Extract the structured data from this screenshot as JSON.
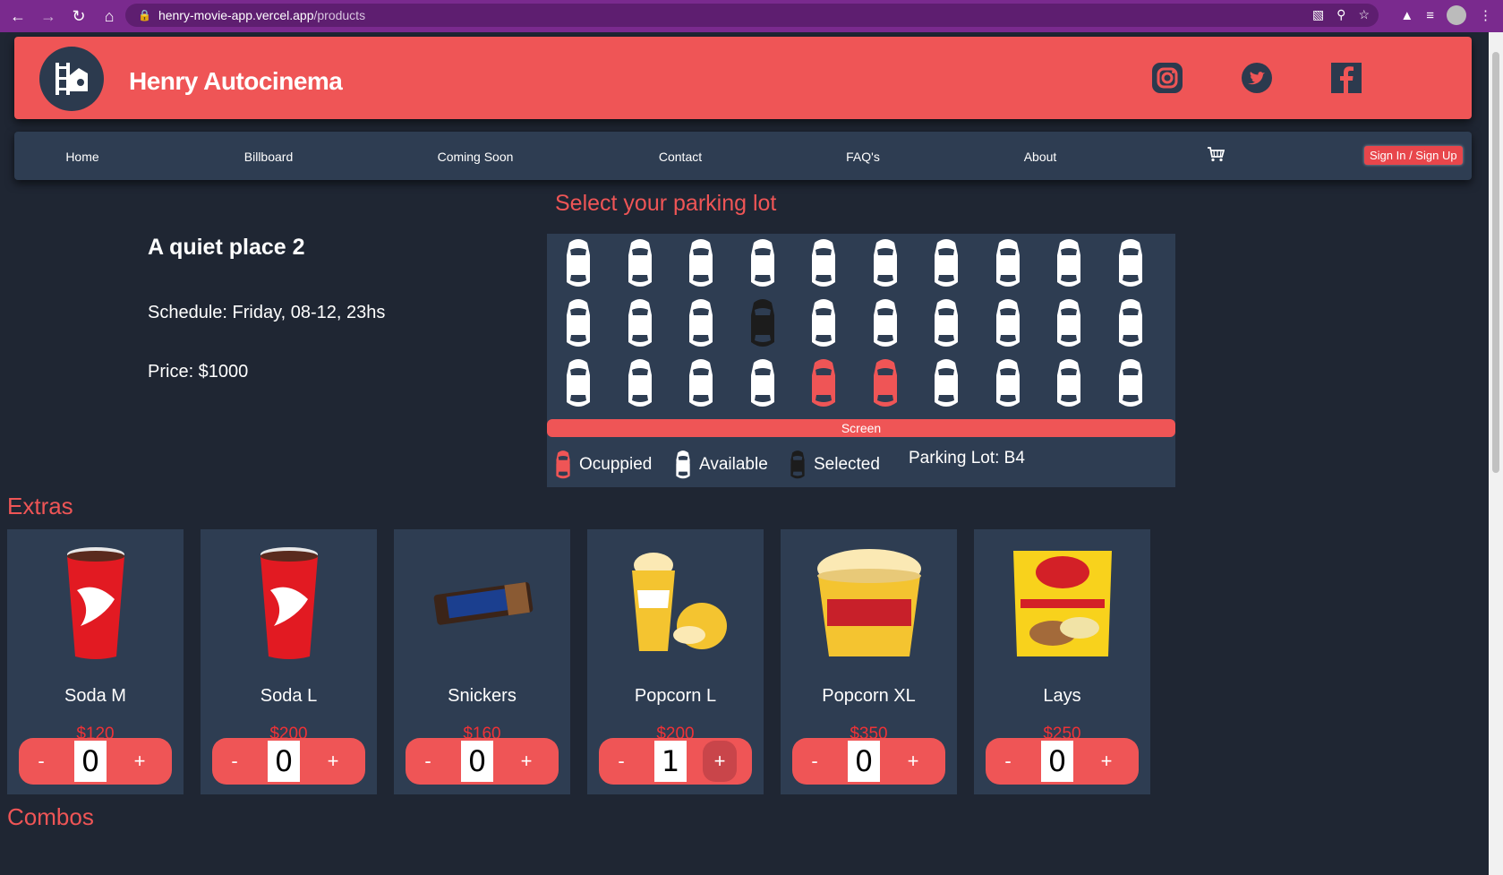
{
  "browser": {
    "url_host": "henry-movie-app.vercel.app",
    "url_path": "/products"
  },
  "header": {
    "brand": "Henry Autocinema"
  },
  "nav": {
    "items": [
      "Home",
      "Billboard",
      "Coming Soon",
      "Contact",
      "FAQ's",
      "About"
    ],
    "signin_label": "Sign In / Sign Up"
  },
  "movie": {
    "title": "A quiet place 2",
    "schedule": "Schedule: Friday, 08-12, 23hs",
    "price": "Price: $1000"
  },
  "parking": {
    "title": "Select your parking lot",
    "screen_label": "Screen",
    "legend": {
      "occupied": "Ocuppied",
      "available": "Available",
      "selected": "Selected",
      "lot": "Parking Lot: B4"
    },
    "rows": [
      [
        "available",
        "available",
        "available",
        "available",
        "available",
        "available",
        "available",
        "available",
        "available",
        "available"
      ],
      [
        "available",
        "available",
        "available",
        "selected",
        "available",
        "available",
        "available",
        "available",
        "available",
        "available"
      ],
      [
        "available",
        "available",
        "available",
        "available",
        "occupied",
        "occupied",
        "available",
        "available",
        "available",
        "available"
      ]
    ],
    "colors": {
      "occupied": "#ef5556",
      "available": "#ffffff",
      "selected": "#1c1c1c"
    }
  },
  "extras": {
    "title": "Extras",
    "items": [
      {
        "name": "Soda M",
        "price": "$120",
        "qty": "0",
        "image": "coca-cola-cup"
      },
      {
        "name": "Soda L",
        "price": "$200",
        "qty": "0",
        "image": "coca-cola-cup"
      },
      {
        "name": "Snickers",
        "price": "$160",
        "qty": "0",
        "image": "snickers-bar"
      },
      {
        "name": "Popcorn L",
        "price": "$200",
        "qty": "1",
        "image": "popcorn-cups"
      },
      {
        "name": "Popcorn XL",
        "price": "$350",
        "qty": "0",
        "image": "popcorn-bucket"
      },
      {
        "name": "Lays",
        "price": "$250",
        "qty": "0",
        "image": "lays-bag"
      }
    ],
    "minus_label": "-",
    "plus_label": "+"
  },
  "combos": {
    "title": "Combos"
  },
  "theme": {
    "accent": "#ef5556",
    "panel": "#2e3d52",
    "background": "#1f2633"
  }
}
